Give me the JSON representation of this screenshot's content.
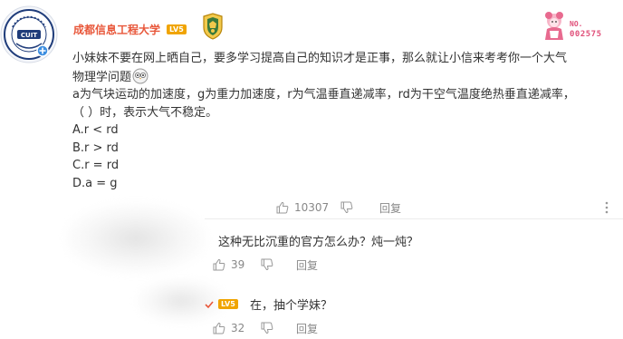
{
  "post": {
    "username": "成都信息工程大学",
    "level_badge": "LV5",
    "number_label": "NO.",
    "number_value": "002575",
    "lines": [
      "小妹妹不要在网上晒自己，要多学习提高自己的知识才是正事，那么就让小信来考考你一个大气",
      "物理学问题",
      "a为气块运动的加速度，g为重力加速度，r为气温垂直递减率，rd为干空气温度绝热垂直递减率，",
      "（  ）时，表示大气不稳定。",
      "A.r < rd",
      "B.r > rd",
      "C.r = rd",
      "D.a = g"
    ],
    "like_count": "10307",
    "reply_label": "回复"
  },
  "replies": [
    {
      "text": "这种无比沉重的官方怎么办？炖一炖？",
      "like_count": "39",
      "reply_label": "回复"
    },
    {
      "level_badge": "LV5",
      "text": "在，抽个学妹？",
      "like_count": "32",
      "reply_label": "回复"
    }
  ],
  "colors": {
    "username": "#e8573a",
    "level_badge": "#f0a400",
    "meta_text": "#888888",
    "number_badge": "#e0507a"
  },
  "icons": [
    "cuit-logo",
    "medal-icon",
    "anime-ornament",
    "thumbs-up-icon",
    "thumbs-down-icon",
    "more-icon",
    "owl-emoji-icon"
  ]
}
